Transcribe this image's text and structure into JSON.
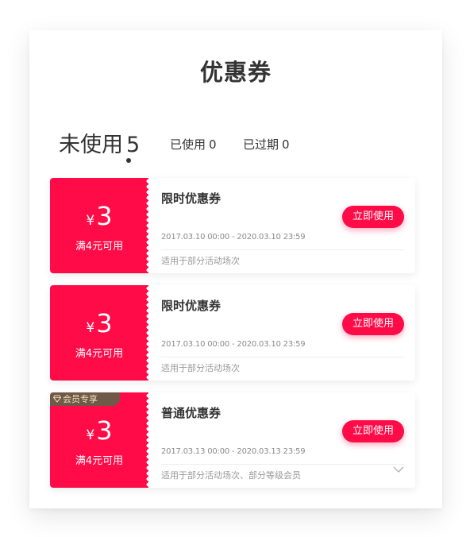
{
  "page": {
    "title": "优惠券"
  },
  "tabs": [
    {
      "label": "未使用",
      "count": "5",
      "active": true
    },
    {
      "label": "已使用",
      "count": "0",
      "active": false
    },
    {
      "label": "已过期",
      "count": "0",
      "active": false
    }
  ],
  "coupons": [
    {
      "currency": "¥",
      "amount": "3",
      "condition": "满4元可用",
      "title": "限时优惠券",
      "button_label": "立即使用",
      "validity": "2017.03.10 00:00 - 2020.03.10 23:59",
      "scope": "适用于部分活动场次"
    },
    {
      "currency": "¥",
      "amount": "3",
      "condition": "满4元可用",
      "title": "限时优惠券",
      "button_label": "立即使用",
      "validity": "2017.03.10 00:00 - 2020.03.10 23:59",
      "scope": "适用于部分活动场次"
    },
    {
      "badge": "会员专享",
      "currency": "¥",
      "amount": "3",
      "condition": "满4元可用",
      "title": "普通优惠券",
      "button_label": "立即使用",
      "validity": "2017.03.13 00:00 - 2020.03.13 23:59",
      "scope": "适用于部分活动场次、部分等级会员",
      "expand_icon": "chevron-down-icon"
    }
  ],
  "colors": {
    "accent": "#ff0b47",
    "text_primary": "#333333",
    "text_secondary": "#8a8a8a",
    "badge_bg": "#6e5a46",
    "badge_text": "#f3dfc4"
  }
}
